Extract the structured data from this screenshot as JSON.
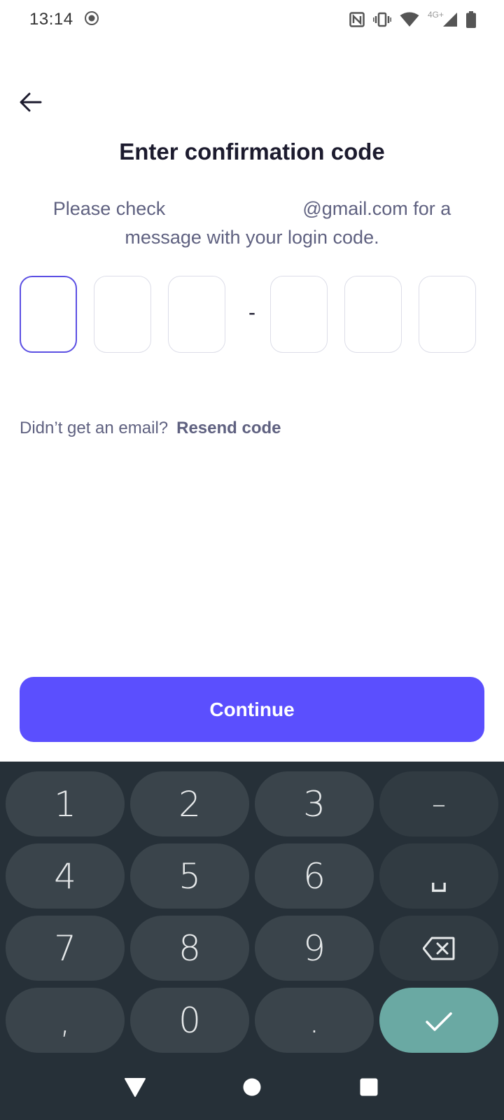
{
  "status_bar": {
    "time": "13:14",
    "network_label": "4G+",
    "icons": [
      "record-icon",
      "nfc-icon",
      "vibrate-icon",
      "wifi-icon",
      "signal-icon",
      "battery-icon"
    ]
  },
  "header": {
    "back_icon": "arrow-left-icon",
    "title": "Enter confirmation code"
  },
  "subtitle": {
    "prefix": "Please check",
    "suffix": "@gmail.com for a",
    "line2": "message with your login code."
  },
  "code_input": {
    "digits": [
      "",
      "",
      "",
      "",
      "",
      ""
    ],
    "separator": "-",
    "active_index": 0
  },
  "resend": {
    "prompt": "Didn’t get an email?",
    "link": "Resend code"
  },
  "continue_button": {
    "label": "Continue"
  },
  "keyboard": {
    "rows": [
      [
        "1",
        "2",
        "3",
        "–"
      ],
      [
        "4",
        "5",
        "6",
        "␣"
      ],
      [
        "7",
        "8",
        "9",
        "backspace"
      ],
      [
        ",",
        "0",
        ".",
        "enter"
      ]
    ],
    "backspace_icon": "backspace-icon",
    "enter_icon": "check-icon"
  },
  "nav_bar": {
    "icons": [
      "back-triangle-icon",
      "home-circle-icon",
      "recents-square-icon"
    ]
  },
  "colors": {
    "accent": "#5b4ffe",
    "active_border": "#5b4fe3",
    "keyboard_bg": "#263038",
    "key_bg": "#3a444b",
    "enter_key": "#6aa9a3"
  }
}
